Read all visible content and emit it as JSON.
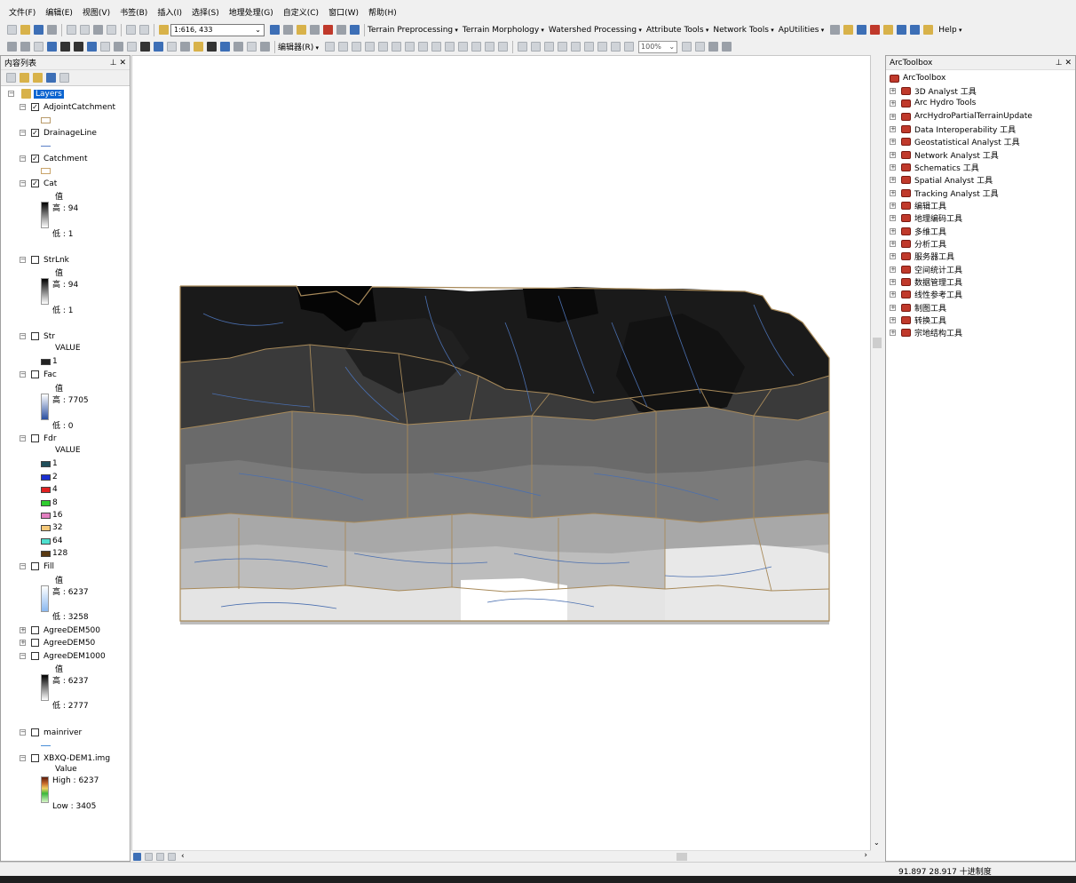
{
  "menu": [
    "文件(F)",
    "编辑(E)",
    "视图(V)",
    "书签(B)",
    "插入(I)",
    "选择(S)",
    "地理处理(G)",
    "自定义(C)",
    "窗口(W)",
    "帮助(H)"
  ],
  "toolbar": {
    "scale": "1:616, 433",
    "dropdowns": [
      "Terrain Preprocessing",
      "Terrain Morphology",
      "Watershed Processing",
      "Attribute Tools",
      "Network Tools",
      "ApUtilities"
    ],
    "help": "Help",
    "editor": "编辑器(R)",
    "zoom": "100%"
  },
  "toc": {
    "title": "内容列表",
    "root": "Layers",
    "layers": [
      {
        "name": "AdjointCatchment",
        "checked": true
      },
      {
        "name": "DrainageLine",
        "checked": true
      },
      {
        "name": "Catchment",
        "checked": true
      },
      {
        "name": "Cat",
        "checked": true,
        "field": "值",
        "high": "高 : 94",
        "low": "低 : 1"
      },
      {
        "name": "StrLnk",
        "checked": false,
        "field": "值",
        "high": "高 : 94",
        "low": "低 : 1"
      },
      {
        "name": "Str",
        "checked": false,
        "field": "VALUE",
        "classes": [
          "1"
        ]
      },
      {
        "name": "Fac",
        "checked": false,
        "field": "值",
        "high": "高 : 7705",
        "low": "低 : 0"
      },
      {
        "name": "Fdr",
        "checked": false,
        "field": "VALUE",
        "classes": [
          "1",
          "2",
          "4",
          "8",
          "16",
          "32",
          "64",
          "128"
        ]
      },
      {
        "name": "Fill",
        "checked": false,
        "field": "值",
        "high": "高 : 6237",
        "low": "低 : 3258"
      },
      {
        "name": "AgreeDEM500",
        "checked": false
      },
      {
        "name": "AgreeDEM50",
        "checked": false
      },
      {
        "name": "AgreeDEM1000",
        "checked": false,
        "field": "值",
        "high": "高 : 6237",
        "low": "低 : 2777"
      },
      {
        "name": "mainriver",
        "checked": false
      },
      {
        "name": "XBXQ-DEM1.img",
        "checked": false,
        "field": "Value",
        "high": "High : 6237",
        "low": "Low : 3405"
      }
    ],
    "fdr_colors": [
      "#1f4e5a",
      "#1a2fd1",
      "#e02020",
      "#2ecc2e",
      "#e27fc0",
      "#f5c97a",
      "#4fe0cf",
      "#5a3a12"
    ]
  },
  "toolbox": {
    "title": "ArcToolbox",
    "root": "ArcToolbox",
    "items": [
      "3D Analyst 工具",
      "Arc Hydro Tools",
      "ArcHydroPartialTerrainUpdate",
      "Data Interoperability 工具",
      "Geostatistical Analyst 工具",
      "Network Analyst 工具",
      "Schematics 工具",
      "Spatial Analyst 工具",
      "Tracking Analyst 工具",
      "编辑工具",
      "地理编码工具",
      "多维工具",
      "分析工具",
      "服务器工具",
      "空间统计工具",
      "数据管理工具",
      "线性参考工具",
      "制图工具",
      "转换工具",
      "宗地结构工具"
    ]
  },
  "status": {
    "coords": "91.897  28.917 十进制度"
  },
  "icons": [
    "new-icon",
    "open-icon",
    "save-icon",
    "print-icon",
    "cut-icon",
    "copy-icon",
    "paste-icon",
    "delete-icon",
    "undo-icon",
    "redo-icon",
    "add-data-icon",
    "zoom-in-icon",
    "zoom-out-icon",
    "pan-icon",
    "full-extent-icon",
    "identify-icon",
    "find-icon",
    "select-icon",
    "pushpin-icon",
    "close-icon",
    "toolbox-icon"
  ]
}
